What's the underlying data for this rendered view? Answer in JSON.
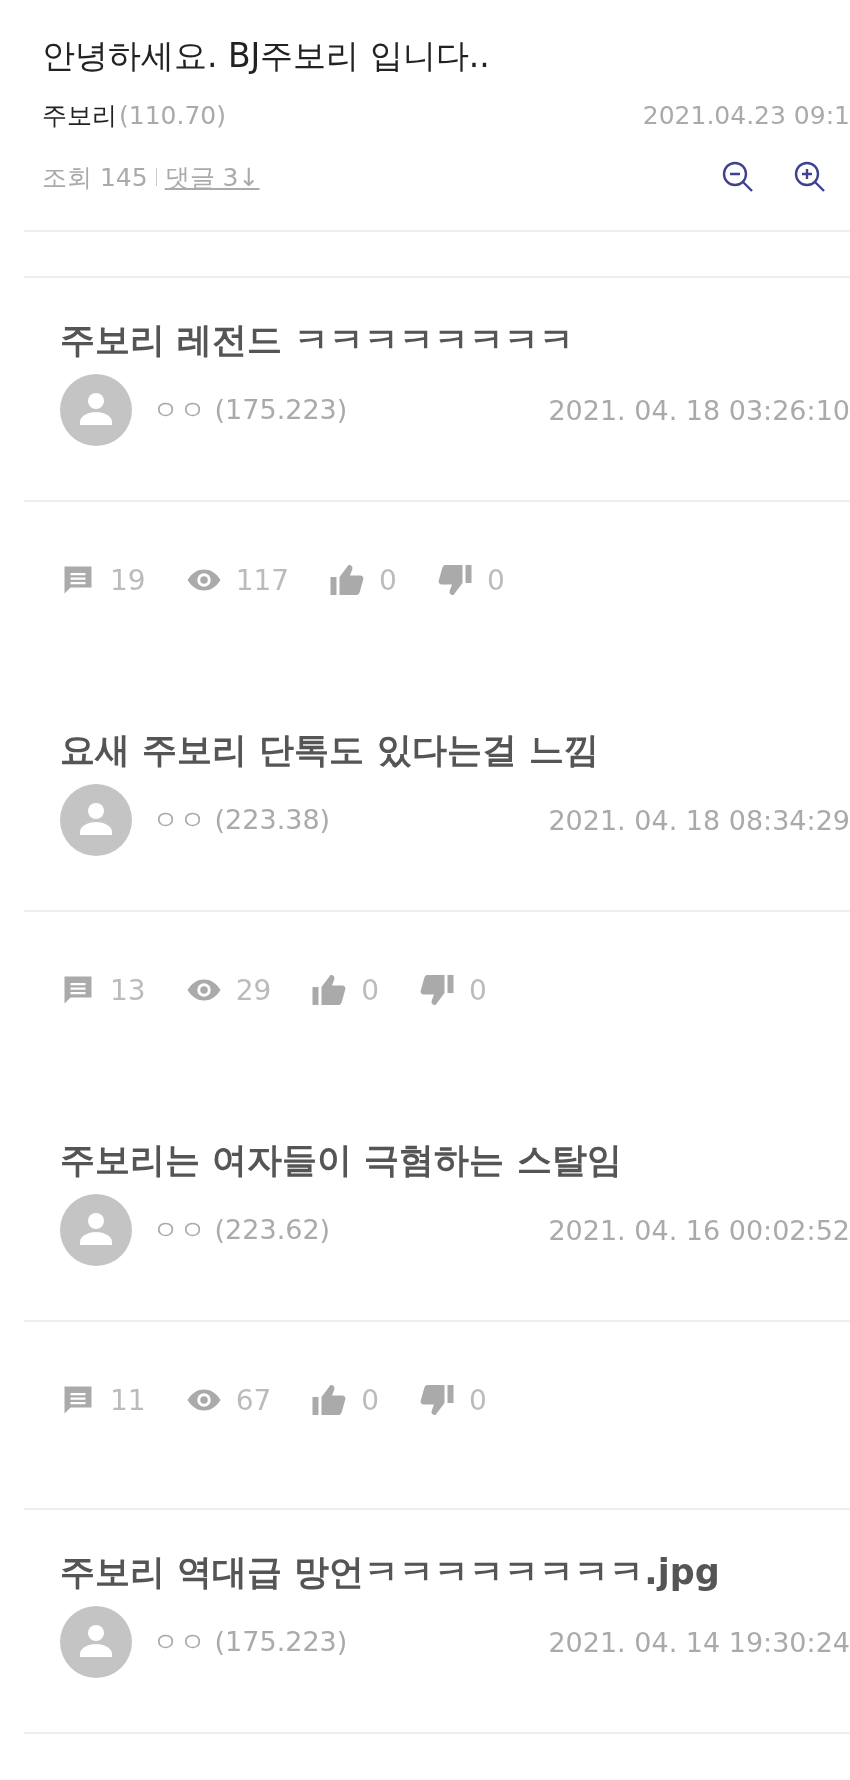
{
  "header": {
    "title": "안녕하세요. BJ주보리 입니다..",
    "author": "주보리",
    "author_ip": "(110.70)",
    "date": "2021.04.23 09:1",
    "views": "조회 145",
    "comments_link": "댓글 3↓"
  },
  "posts": [
    {
      "title": "주보리 레전드 ㅋㅋㅋㅋㅋㅋㅋㅋ",
      "author": "ㅇㅇ (175.223)",
      "date": "2021. 04. 18 03:26:10",
      "stats": {
        "comments": "19",
        "views": "117",
        "likes": "0",
        "dislikes": "0"
      }
    },
    {
      "title": "요새 주보리 단톡도 있다는걸 느낌",
      "author": "ㅇㅇ (223.38)",
      "date": "2021. 04. 18 08:34:29",
      "stats": {
        "comments": "13",
        "views": "29",
        "likes": "0",
        "dislikes": "0"
      }
    },
    {
      "title": "주보리는 여자들이 극혐하는 스탈임",
      "author": "ㅇㅇ (223.62)",
      "date": "2021. 04. 16 00:02:52",
      "stats": {
        "comments": "11",
        "views": "67",
        "likes": "0",
        "dislikes": "0"
      }
    },
    {
      "title": "주보리 역대급 망언ㅋㅋㅋㅋㅋㅋㅋㅋ.jpg",
      "author": "ㅇㅇ (175.223)",
      "date": "2021. 04. 14 19:30:24"
    }
  ]
}
